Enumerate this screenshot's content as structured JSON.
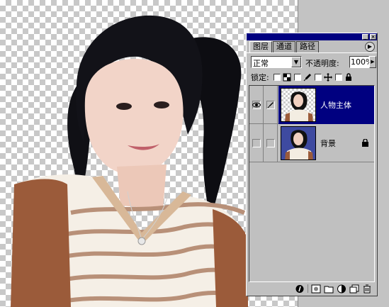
{
  "palette": {
    "tabs": [
      {
        "label": "图层",
        "active": true
      },
      {
        "label": "通道",
        "active": false
      },
      {
        "label": "路径",
        "active": false
      }
    ],
    "blend_mode": "正常",
    "opacity_label": "不透明度:",
    "opacity_value": "100%",
    "lock_label": "锁定:",
    "layers": [
      {
        "name": "人物主体",
        "visible": true,
        "active": true
      },
      {
        "name": "背景",
        "visible": false,
        "active": false,
        "locked": true
      }
    ]
  },
  "colors": {
    "selection": "#000080",
    "panel": "#c0c0c0",
    "workspace": "#c3c3c3"
  }
}
